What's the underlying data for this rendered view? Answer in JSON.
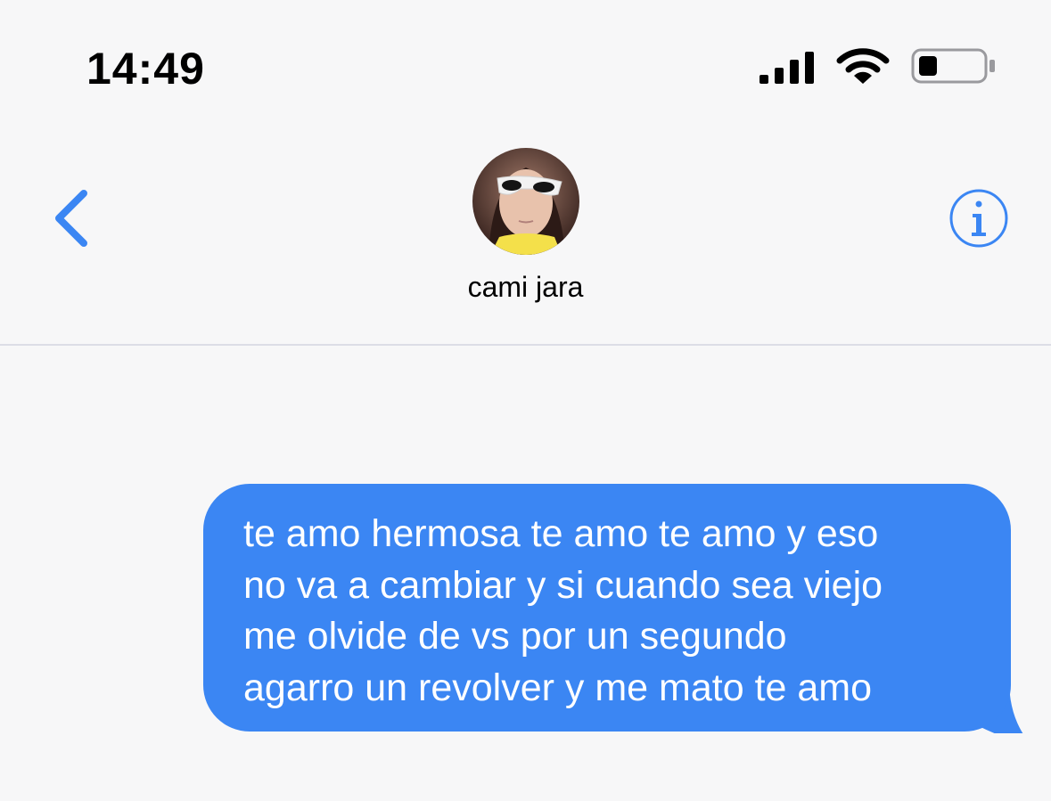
{
  "status_bar": {
    "time": "14:49",
    "signal_icon": "cellular-signal-icon",
    "wifi_icon": "wifi-icon",
    "battery_icon": "battery-icon",
    "battery_level": 0.3
  },
  "header": {
    "back_icon": "chevron-left-icon",
    "info_icon": "info-icon",
    "contact_name": "cami jara"
  },
  "messages": [
    {
      "direction": "sent",
      "lines": [
        "te amo hermosa te amo te amo y eso",
        "no va a cambiar y si cuando sea viejo",
        "me olvide de vs por un segundo",
        "agarro un revolver y me mato te amo"
      ]
    }
  ],
  "colors": {
    "accent": "#3b86f3",
    "background": "#f7f7f8",
    "divider": "#dcdde6"
  }
}
